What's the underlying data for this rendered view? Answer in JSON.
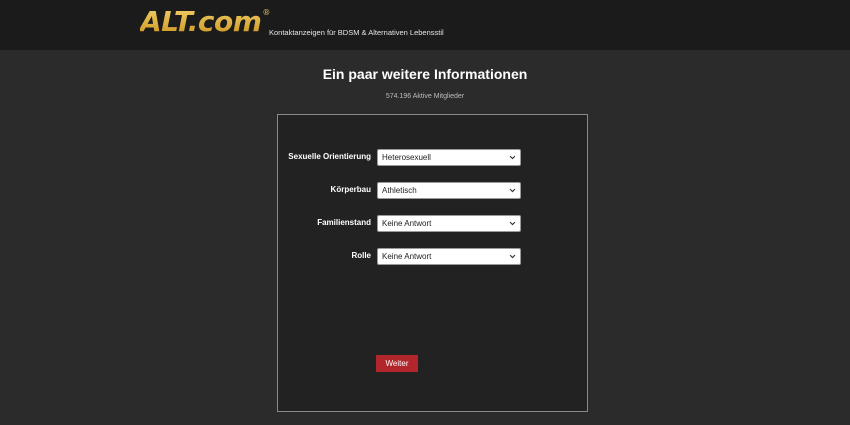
{
  "header": {
    "logo_text": "ALT.com",
    "logo_reg": "®",
    "tagline": "Kontaktanzeigen für BDSM & Alternativen Lebensstil"
  },
  "main": {
    "title": "Ein paar weitere Informationen",
    "active_members": "574.196 Aktive Mitglieder"
  },
  "form": {
    "fields": [
      {
        "label": "Sexuelle Orientierung",
        "value": "Heterosexuell"
      },
      {
        "label": "Körperbau",
        "value": "Athletisch"
      },
      {
        "label": "Familienstand",
        "value": "Keine Antwort"
      },
      {
        "label": "Rolle",
        "value": "Keine Antwort"
      }
    ],
    "submit_label": "Weiter"
  },
  "colors": {
    "header_bg": "#1b1b1b",
    "page_bg": "#2b2b2b",
    "logo_gold": "#d7a82a",
    "button_red": "#b1262a"
  },
  "icons": {
    "select_arrow": "chevron-down-icon"
  }
}
